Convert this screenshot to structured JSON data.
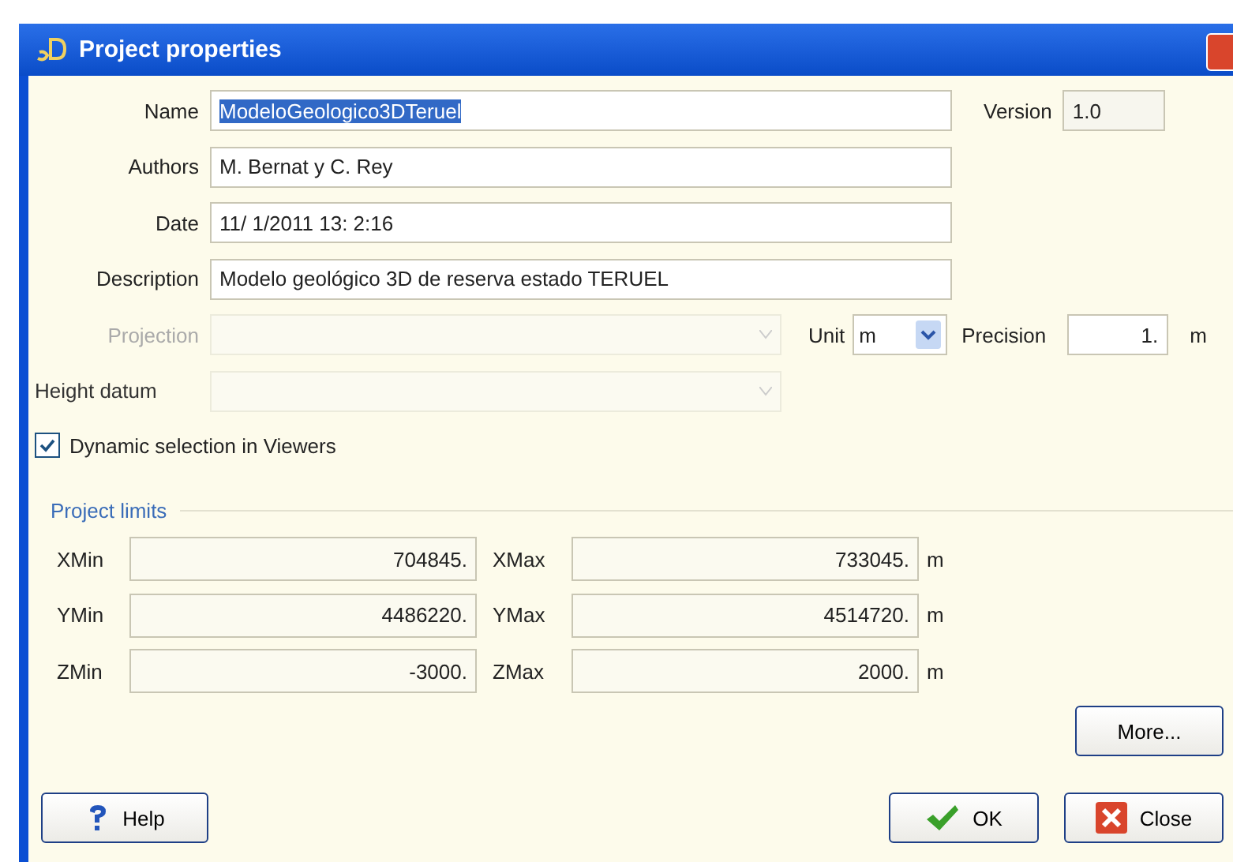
{
  "window": {
    "title": "Project properties"
  },
  "fields": [
    {
      "label": "Name",
      "value": "ModeloGeologico3DTeruel",
      "selected": true
    },
    {
      "label": "Authors",
      "value": "M. Bernat y C. Rey",
      "selected": false
    },
    {
      "label": "Date",
      "value": "11/ 1/2011 13: 2:16",
      "selected": false
    },
    {
      "label": "Description",
      "value": "Modelo geológico 3D de reserva estado TERUEL",
      "selected": false
    }
  ],
  "version": {
    "label": "Version",
    "value": "1.0"
  },
  "projection": {
    "label": "Projection",
    "disabled": true
  },
  "unit": {
    "label": "Unit",
    "value": "m"
  },
  "precision": {
    "label": "Precision",
    "value": "1.",
    "unit": "m"
  },
  "height_datum": {
    "label": "Height datum",
    "disabled": true
  },
  "dynamic_selection": {
    "label": "Dynamic selection in Viewers",
    "checked": true
  },
  "project_limits": {
    "title": "Project limits",
    "rows": [
      {
        "min_label": "XMin",
        "min": "704845.",
        "max_label": "XMax",
        "max": "733045.",
        "unit": "m"
      },
      {
        "min_label": "YMin",
        "min": "4486220.",
        "max_label": "YMax",
        "max": "4514720.",
        "unit": "m"
      },
      {
        "min_label": "ZMin",
        "min": "-3000.",
        "max_label": "ZMax",
        "max": "2000.",
        "unit": "m"
      }
    ]
  },
  "more_button": {
    "label": "More..."
  },
  "buttons": [
    {
      "label": "Help",
      "kind": "help"
    },
    {
      "label": "OK",
      "kind": "ok"
    },
    {
      "label": "Close",
      "kind": "close"
    }
  ]
}
